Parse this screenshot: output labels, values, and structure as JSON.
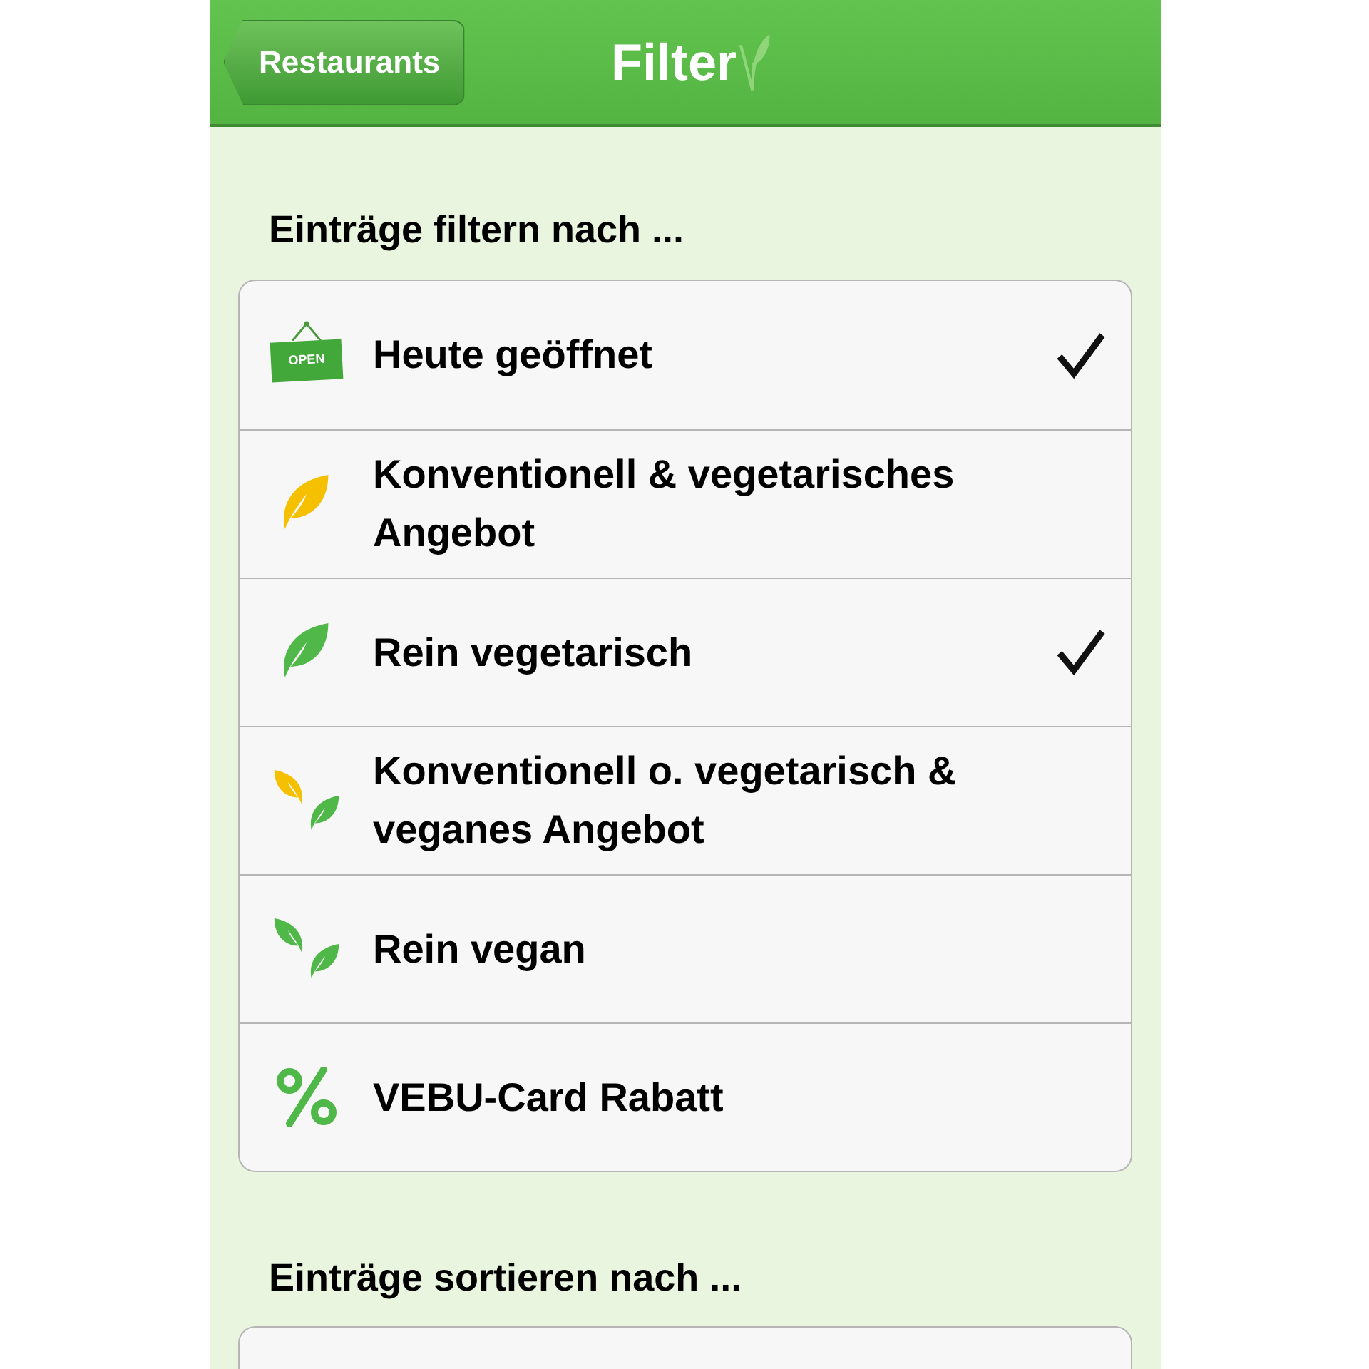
{
  "nav_bar": {
    "back_button": "Restaurants",
    "title": "Filter"
  },
  "filter_section": {
    "heading": "Einträge filtern nach ...",
    "items": [
      {
        "kind": "open-sign",
        "sign_text": "OPEN",
        "label": "Heute geöffnet",
        "checked": true
      },
      {
        "kind": "leaf-yellow",
        "label": "Konventionell & vegetarisches Angebot",
        "checked": false
      },
      {
        "kind": "leaf-green",
        "label": "Rein vegetarisch",
        "checked": true
      },
      {
        "kind": "leaves-yellow-green",
        "label": "Konventionell o. vegetarisch & veganes Angebot",
        "checked": false
      },
      {
        "kind": "leaves-green",
        "label": "Rein vegan",
        "checked": false
      },
      {
        "kind": "percent",
        "label": "VEBU-Card Rabatt",
        "checked": false
      }
    ]
  },
  "sort_section": {
    "heading": "Einträge sortieren nach ..."
  }
}
